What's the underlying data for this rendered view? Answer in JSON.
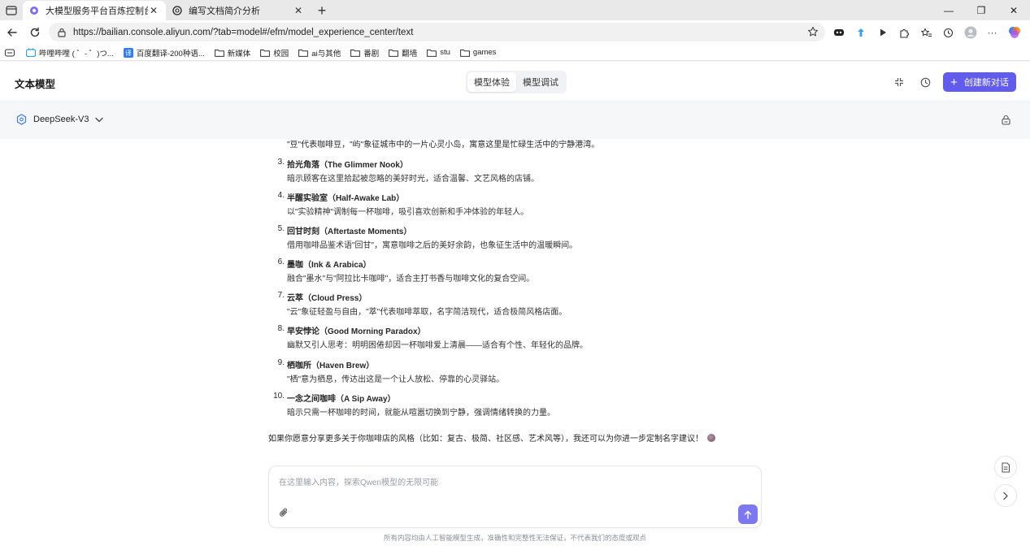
{
  "browser": {
    "tabs": [
      {
        "title": "大模型服务平台百炼控制台",
        "icon": "bailian-favicon",
        "active": true
      },
      {
        "title": "编写文档简介分析",
        "icon": "openai-favicon",
        "active": false
      }
    ],
    "new_tab": "+",
    "window_controls": {
      "minimize": "—",
      "restore": "❐",
      "close": "✕"
    },
    "url": "https://bailian.console.aliyun.com/?tab=model#/efm/model_experience_center/text",
    "bookmarks": [
      {
        "label": "哔哩哔哩 ( ゜- ゜)つ...",
        "icon": "bilibili-icon"
      },
      {
        "label": "百度翻译-200种语...",
        "icon": "baidu-translate-icon"
      },
      {
        "label": "新媒体",
        "icon": "folder-icon"
      },
      {
        "label": "校园",
        "icon": "folder-icon"
      },
      {
        "label": "ai与其他",
        "icon": "folder-icon"
      },
      {
        "label": "番剧",
        "icon": "folder-icon"
      },
      {
        "label": "翻墙",
        "icon": "folder-icon"
      },
      {
        "label": "stu",
        "icon": "folder-icon"
      },
      {
        "label": "games",
        "icon": "folder-icon"
      }
    ]
  },
  "app": {
    "title": "文本模型",
    "tabs": [
      "模型体验",
      "模型调试"
    ],
    "active_tab": "模型体验",
    "new_chat_label": "创建新对话",
    "accent_color": "#615ced",
    "model_name": "DeepSeek-V3"
  },
  "conversation": {
    "partial_line": "\"豆\"代表咖啡豆，\"屿\"象征城市中的一片心灵小岛，寓意这里是忙碌生活中的宁静港湾。",
    "items": [
      {
        "num": "3.",
        "title": "拾光角落（The Glimmer Nook）",
        "desc": "暗示顾客在这里拾起被忽略的美好时光，适合温馨、文艺风格的店铺。"
      },
      {
        "num": "4.",
        "title": "半醒实验室（Half-Awake Lab）",
        "desc": "以\"实验精神\"调制每一杯咖啡，吸引喜欢创新和手冲体验的年轻人。"
      },
      {
        "num": "5.",
        "title": "回甘时刻（Aftertaste Moments）",
        "desc": "借用咖啡品鉴术语\"回甘\"，寓意咖啡之后的美好余韵，也象征生活中的温暖瞬间。"
      },
      {
        "num": "6.",
        "title": "墨咖（Ink & Arabica）",
        "desc": "融合\"墨水\"与\"阿拉比卡咖啡\"，适合主打书香与咖啡文化的复合空间。"
      },
      {
        "num": "7.",
        "title": "云萃（Cloud Press）",
        "desc": "\"云\"象征轻盈与自由，\"萃\"代表咖啡萃取，名字简洁现代，适合极简风格店面。"
      },
      {
        "num": "8.",
        "title": "早安悖论（Good Morning Paradox）",
        "desc": "幽默又引人思考：明明困倦却因一杯咖啡爱上清晨——适合有个性、年轻化的品牌。"
      },
      {
        "num": "9.",
        "title": "栖咖所（Haven Brew）",
        "desc": "\"栖\"意为栖息，传达出这是一个让人放松、停靠的心灵驿站。"
      },
      {
        "num": "10.",
        "title": "一念之间咖啡（A Sip Away）",
        "desc": "暗示只需一杯咖啡的时间，就能从喧嚣切换到宁静，强调情绪转换的力量。"
      }
    ],
    "closing": "如果你愿意分享更多关于你咖啡店的风格（比如：复古、极简、社区感、艺术风等），我还可以为你进一步定制名字建议！"
  },
  "input": {
    "placeholder": "在这里输入内容，探索Qwen模型的无限可能",
    "disclaimer": "所有内容均由人工智能模型生成，准确性和完整性无法保证，不代表我们的态度或观点"
  }
}
